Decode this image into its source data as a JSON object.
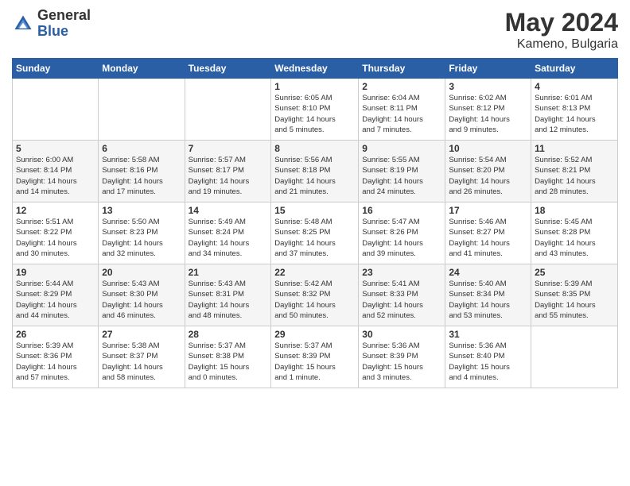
{
  "header": {
    "logo_general": "General",
    "logo_blue": "Blue",
    "month_year": "May 2024",
    "location": "Kameno, Bulgaria"
  },
  "days_of_week": [
    "Sunday",
    "Monday",
    "Tuesday",
    "Wednesday",
    "Thursday",
    "Friday",
    "Saturday"
  ],
  "weeks": [
    [
      {
        "day": "",
        "info": ""
      },
      {
        "day": "",
        "info": ""
      },
      {
        "day": "",
        "info": ""
      },
      {
        "day": "1",
        "info": "Sunrise: 6:05 AM\nSunset: 8:10 PM\nDaylight: 14 hours\nand 5 minutes."
      },
      {
        "day": "2",
        "info": "Sunrise: 6:04 AM\nSunset: 8:11 PM\nDaylight: 14 hours\nand 7 minutes."
      },
      {
        "day": "3",
        "info": "Sunrise: 6:02 AM\nSunset: 8:12 PM\nDaylight: 14 hours\nand 9 minutes."
      },
      {
        "day": "4",
        "info": "Sunrise: 6:01 AM\nSunset: 8:13 PM\nDaylight: 14 hours\nand 12 minutes."
      }
    ],
    [
      {
        "day": "5",
        "info": "Sunrise: 6:00 AM\nSunset: 8:14 PM\nDaylight: 14 hours\nand 14 minutes."
      },
      {
        "day": "6",
        "info": "Sunrise: 5:58 AM\nSunset: 8:16 PM\nDaylight: 14 hours\nand 17 minutes."
      },
      {
        "day": "7",
        "info": "Sunrise: 5:57 AM\nSunset: 8:17 PM\nDaylight: 14 hours\nand 19 minutes."
      },
      {
        "day": "8",
        "info": "Sunrise: 5:56 AM\nSunset: 8:18 PM\nDaylight: 14 hours\nand 21 minutes."
      },
      {
        "day": "9",
        "info": "Sunrise: 5:55 AM\nSunset: 8:19 PM\nDaylight: 14 hours\nand 24 minutes."
      },
      {
        "day": "10",
        "info": "Sunrise: 5:54 AM\nSunset: 8:20 PM\nDaylight: 14 hours\nand 26 minutes."
      },
      {
        "day": "11",
        "info": "Sunrise: 5:52 AM\nSunset: 8:21 PM\nDaylight: 14 hours\nand 28 minutes."
      }
    ],
    [
      {
        "day": "12",
        "info": "Sunrise: 5:51 AM\nSunset: 8:22 PM\nDaylight: 14 hours\nand 30 minutes."
      },
      {
        "day": "13",
        "info": "Sunrise: 5:50 AM\nSunset: 8:23 PM\nDaylight: 14 hours\nand 32 minutes."
      },
      {
        "day": "14",
        "info": "Sunrise: 5:49 AM\nSunset: 8:24 PM\nDaylight: 14 hours\nand 34 minutes."
      },
      {
        "day": "15",
        "info": "Sunrise: 5:48 AM\nSunset: 8:25 PM\nDaylight: 14 hours\nand 37 minutes."
      },
      {
        "day": "16",
        "info": "Sunrise: 5:47 AM\nSunset: 8:26 PM\nDaylight: 14 hours\nand 39 minutes."
      },
      {
        "day": "17",
        "info": "Sunrise: 5:46 AM\nSunset: 8:27 PM\nDaylight: 14 hours\nand 41 minutes."
      },
      {
        "day": "18",
        "info": "Sunrise: 5:45 AM\nSunset: 8:28 PM\nDaylight: 14 hours\nand 43 minutes."
      }
    ],
    [
      {
        "day": "19",
        "info": "Sunrise: 5:44 AM\nSunset: 8:29 PM\nDaylight: 14 hours\nand 44 minutes."
      },
      {
        "day": "20",
        "info": "Sunrise: 5:43 AM\nSunset: 8:30 PM\nDaylight: 14 hours\nand 46 minutes."
      },
      {
        "day": "21",
        "info": "Sunrise: 5:43 AM\nSunset: 8:31 PM\nDaylight: 14 hours\nand 48 minutes."
      },
      {
        "day": "22",
        "info": "Sunrise: 5:42 AM\nSunset: 8:32 PM\nDaylight: 14 hours\nand 50 minutes."
      },
      {
        "day": "23",
        "info": "Sunrise: 5:41 AM\nSunset: 8:33 PM\nDaylight: 14 hours\nand 52 minutes."
      },
      {
        "day": "24",
        "info": "Sunrise: 5:40 AM\nSunset: 8:34 PM\nDaylight: 14 hours\nand 53 minutes."
      },
      {
        "day": "25",
        "info": "Sunrise: 5:39 AM\nSunset: 8:35 PM\nDaylight: 14 hours\nand 55 minutes."
      }
    ],
    [
      {
        "day": "26",
        "info": "Sunrise: 5:39 AM\nSunset: 8:36 PM\nDaylight: 14 hours\nand 57 minutes."
      },
      {
        "day": "27",
        "info": "Sunrise: 5:38 AM\nSunset: 8:37 PM\nDaylight: 14 hours\nand 58 minutes."
      },
      {
        "day": "28",
        "info": "Sunrise: 5:37 AM\nSunset: 8:38 PM\nDaylight: 15 hours\nand 0 minutes."
      },
      {
        "day": "29",
        "info": "Sunrise: 5:37 AM\nSunset: 8:39 PM\nDaylight: 15 hours\nand 1 minute."
      },
      {
        "day": "30",
        "info": "Sunrise: 5:36 AM\nSunset: 8:39 PM\nDaylight: 15 hours\nand 3 minutes."
      },
      {
        "day": "31",
        "info": "Sunrise: 5:36 AM\nSunset: 8:40 PM\nDaylight: 15 hours\nand 4 minutes."
      },
      {
        "day": "",
        "info": ""
      }
    ]
  ]
}
